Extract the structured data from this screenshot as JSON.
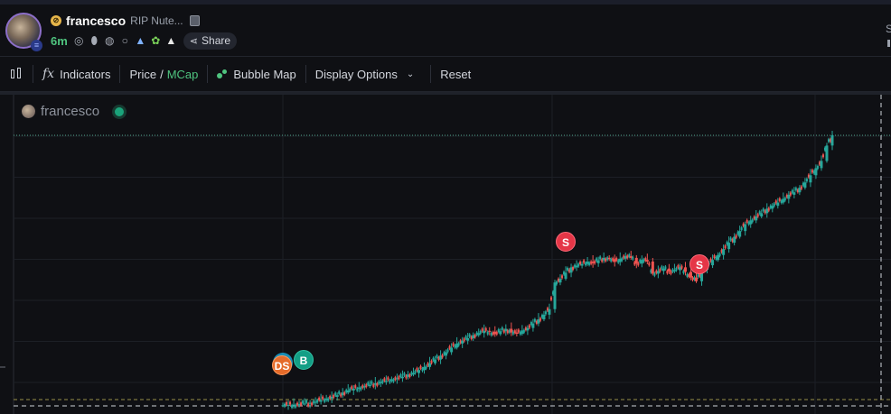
{
  "header": {
    "ticker": "francesco",
    "full_name": "RIP Nute...",
    "age": "6m",
    "share_label": "Share",
    "right_glyph": "S",
    "icons": [
      "search-token-icon",
      "pill-icon",
      "globe-icon",
      "search-icon",
      "rocket-icon",
      "frog-icon",
      "mountain-icon",
      "share-icon"
    ]
  },
  "toolbar": {
    "indicators_label": "Indicators",
    "price_label": "Price",
    "slash": "/",
    "mcap_label": "MCap",
    "bubble_map_label": "Bubble Map",
    "display_options_label": "Display Options",
    "reset_label": "Reset"
  },
  "chart": {
    "legend_label": "francesco",
    "markers": [
      {
        "label": "S",
        "kind": "sell"
      },
      {
        "label": "S",
        "kind": "sell"
      },
      {
        "label": "B",
        "kind": "buy"
      },
      {
        "label": "DS",
        "kind": "dev"
      }
    ],
    "colors": {
      "up": "#26a69a",
      "down": "#ef5350",
      "grid": "#1c1f26"
    }
  },
  "chart_data": {
    "type": "candlestick",
    "series": [
      {
        "values": [
          0.3,
          0.4,
          0.6,
          0.9,
          1.1,
          1.5,
          2,
          2.8,
          3.6,
          4.4,
          5.2,
          6.5,
          7.5,
          8.4,
          9,
          9.6,
          10.3,
          11,
          11.6,
          12.2,
          13,
          13.5,
          14.2,
          15.3,
          16,
          17.5,
          19,
          20.8,
          22.6,
          24.5,
          26.2,
          28.4,
          30.4,
          31.8,
          33,
          34.5,
          35.5,
          36.6,
          36.2,
          35,
          36.4,
          37.6,
          35.8,
          35.2,
          36.8,
          38,
          40.2,
          42.2,
          44.5,
          47.2,
          60.2,
          62,
          65,
          67.6,
          68.4,
          69.2,
          70.4,
          69.6,
          71,
          72.2,
          71.6,
          70.2,
          71.8,
          73,
          72.2,
          69.4,
          71.2,
          70.4,
          64.5,
          65.8,
          67,
          65.6,
          66.2,
          67.6,
          65.4,
          62.6,
          60.8,
          66.4,
          68.6,
          71.2,
          73.6,
          76.5,
          79.6,
          82.5,
          85.3,
          88.6,
          90.5,
          92.4,
          94,
          96.2,
          97.6,
          99.2,
          101,
          103,
          104.2,
          106.4,
          109,
          112.5,
          116,
          119.5,
          127,
          132
        ]
      }
    ]
  }
}
